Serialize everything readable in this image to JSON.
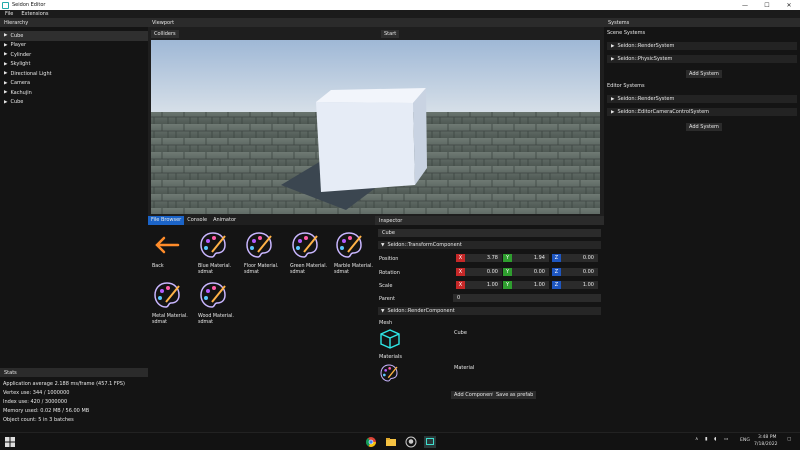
{
  "window": {
    "title": "Seidon Editor",
    "controls": [
      "—",
      "☐",
      "✕"
    ]
  },
  "menu": [
    "File",
    "Extensions"
  ],
  "hierarchy": {
    "title": "Hierarchy",
    "items": [
      "Cube",
      "Player",
      "Cylinder",
      "Skylight",
      "Directional Light",
      "Camera",
      "Kachujin",
      "Cube"
    ]
  },
  "stats": {
    "title": "Stats",
    "lines": [
      "Application average 2.188 ms/frame (457.1 FPS)",
      "Vertex use: 344 / 1000000",
      "Index use: 420 / 3000000",
      "Memory used: 0.02 MB / 56.00 MB",
      "Object count: 5 in 3 batches"
    ]
  },
  "viewport": {
    "title": "Viewport",
    "colliders_label": "Colliders",
    "start_label": "Start"
  },
  "filebrowser": {
    "tabs": [
      "File Browser",
      "Console",
      "Animator"
    ],
    "assets": [
      {
        "name": "Back",
        "icon": "back-arrow-icon"
      },
      {
        "name": "Blue Material. sdmat",
        "icon": "palette-icon"
      },
      {
        "name": "Floor Material. sdmat",
        "icon": "palette-icon"
      },
      {
        "name": "Green Material. sdmat",
        "icon": "palette-icon"
      },
      {
        "name": "Marble Material. sdmat",
        "icon": "palette-icon"
      },
      {
        "name": "Metal Material. sdmat",
        "icon": "palette-icon"
      },
      {
        "name": "Wood Material. sdmat",
        "icon": "palette-icon"
      }
    ]
  },
  "inspector": {
    "title": "Inspector",
    "name": "Cube",
    "transform": {
      "header": "Seidon::TransformComponent",
      "position_label": "Position",
      "rotation_label": "Rotation",
      "scale_label": "Scale",
      "parent_label": "Parent",
      "position": [
        "3.78",
        "1.94",
        "0.00"
      ],
      "rotation": [
        "0.00",
        "0.00",
        "0.00"
      ],
      "scale": [
        "1.00",
        "1.00",
        "1.00"
      ],
      "parent": "0",
      "axes": [
        "X",
        "Y",
        "Z"
      ]
    },
    "render": {
      "header": "Seidon::RenderComponent",
      "mesh_label": "Mesh",
      "mesh_value": "Cube",
      "materials_label": "Materials",
      "material_value": "Material"
    },
    "add_component": "Add Component",
    "save_prefab": "Save as prefab"
  },
  "systems": {
    "title": "Systems",
    "scene_label": "Scene Systems",
    "scene": [
      "Seidon::RenderSystem",
      "Seidon::PhysicSystem"
    ],
    "editor_label": "Editor Systems",
    "editor": [
      "Seidon::RenderSystem",
      "Seidon::EditorCameraControlSystem"
    ],
    "add_system": "Add System"
  },
  "taskbar": {
    "time": "3:48 PM",
    "date": "7/18/2022",
    "lang": "ENG",
    "apps": [
      "chrome-icon",
      "file-explorer-icon",
      "github-icon",
      "seidon-editor-icon"
    ]
  }
}
